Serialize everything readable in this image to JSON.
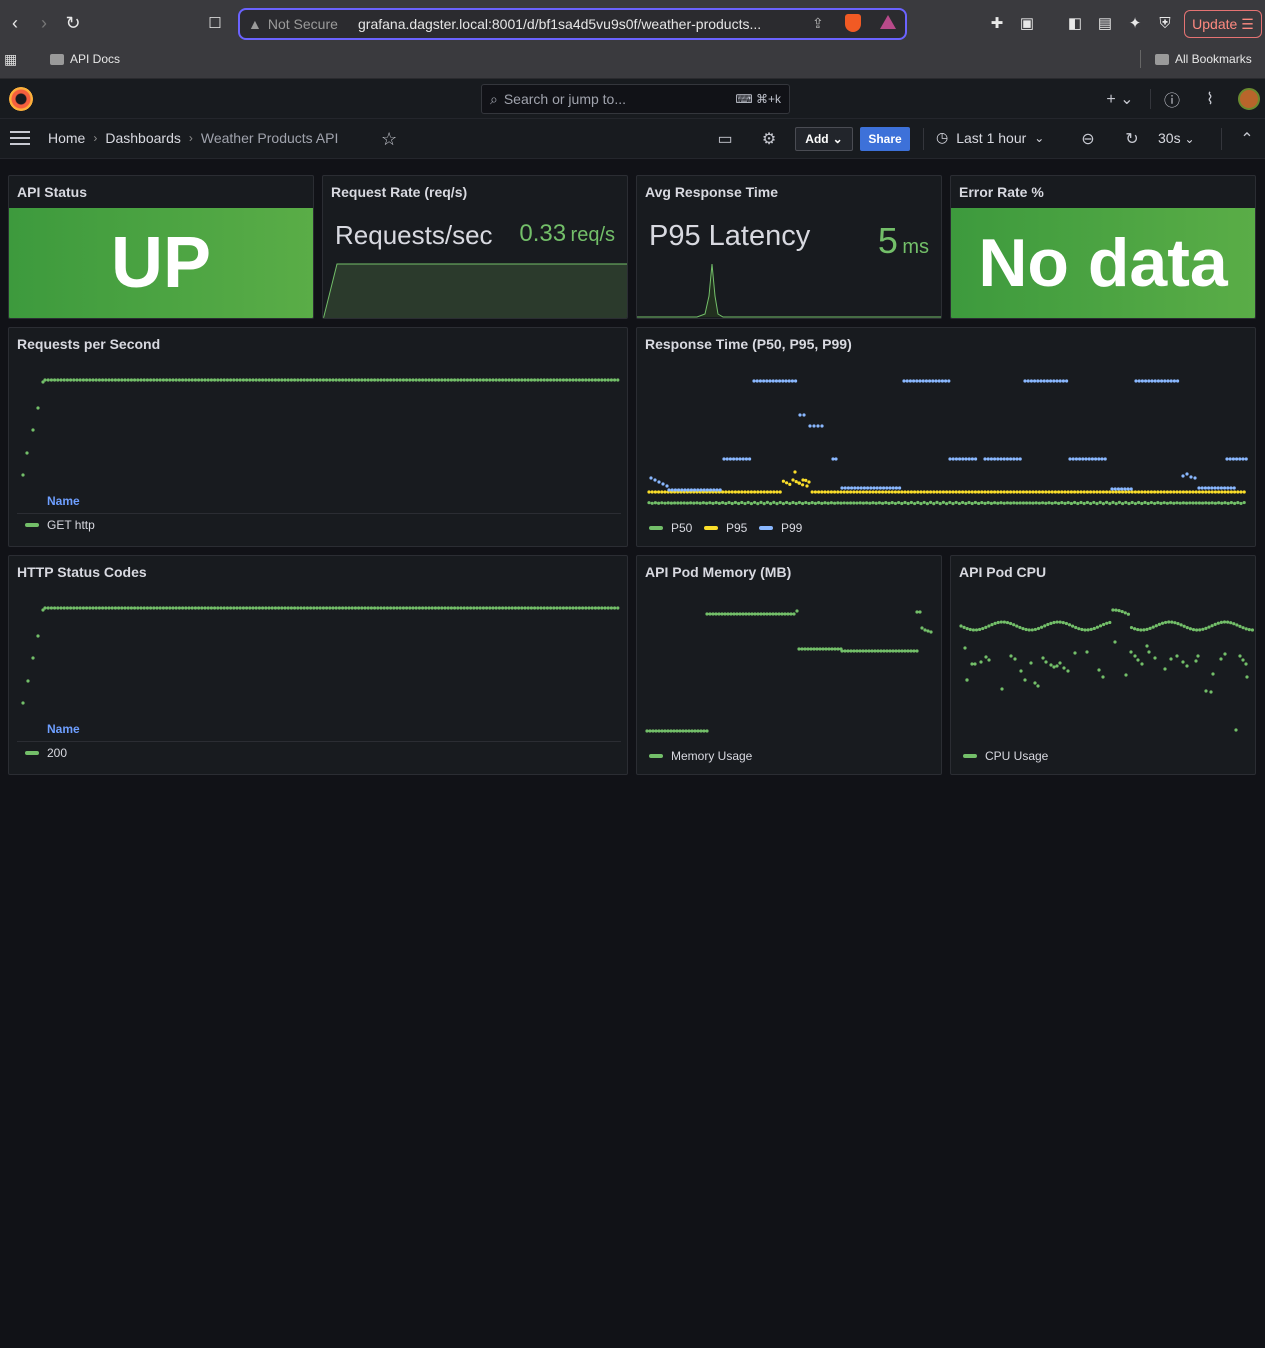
{
  "browser": {
    "url_warning": "Not Secure",
    "url": "grafana.dagster.local:8001/d/bf1sa4d5vu9s0f/weather-products...",
    "update_label": "Update",
    "bookmarks": {
      "api_docs": "API Docs",
      "all_bookmarks": "All Bookmarks"
    }
  },
  "header": {
    "search_placeholder": "Search or jump to...",
    "search_shortcut": "⌘+k"
  },
  "nav": {
    "breadcrumbs": [
      "Home",
      "Dashboards",
      "Weather Products API"
    ],
    "add_label": "Add",
    "share_label": "Share",
    "time_range": "Last 1 hour",
    "refresh_interval": "30s"
  },
  "panels": {
    "api_status": {
      "title": "API Status",
      "value": "UP"
    },
    "request_rate": {
      "title": "Request Rate (req/s)",
      "label": "Requests/sec",
      "value": "0.33",
      "unit": "req/s"
    },
    "avg_response": {
      "title": "Avg Response Time",
      "label": "P95 Latency",
      "value": "5",
      "unit": "ms"
    },
    "error_rate": {
      "title": "Error Rate %",
      "value": "No data"
    },
    "rps": {
      "title": "Requests per Second",
      "legend_header": "Name",
      "legend": [
        {
          "name": "GET http",
          "color": "#73bf69"
        }
      ]
    },
    "response_time": {
      "title": "Response Time (P50, P95, P99)",
      "legend": [
        {
          "name": "P50",
          "color": "#73bf69"
        },
        {
          "name": "P95",
          "color": "#fade2a"
        },
        {
          "name": "P99",
          "color": "#8ab8ff"
        }
      ]
    },
    "http_status": {
      "title": "HTTP Status Codes",
      "legend_header": "Name",
      "legend": [
        {
          "name": "200",
          "color": "#73bf69"
        }
      ]
    },
    "pod_memory": {
      "title": "API Pod Memory (MB)",
      "legend": [
        {
          "name": "Memory Usage",
          "color": "#73bf69"
        }
      ]
    },
    "pod_cpu": {
      "title": "API Pod CPU",
      "legend": [
        {
          "name": "CPU Usage",
          "color": "#73bf69"
        }
      ]
    }
  },
  "colors": {
    "green": "#73bf69",
    "stat_green": "#56a64b",
    "yellow": "#fade2a",
    "blue": "#8ab8ff",
    "share_blue": "#3d71d9"
  }
}
